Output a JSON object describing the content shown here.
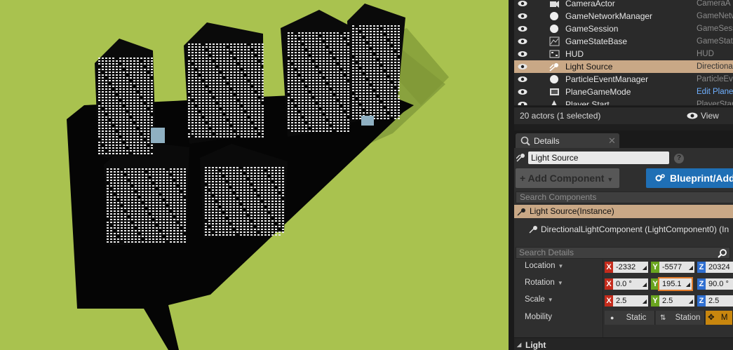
{
  "outliner": {
    "rows": [
      {
        "name": "CameraActor",
        "type": "CameraA",
        "icon": "camera-actor-icon"
      },
      {
        "name": "GameNetworkManager",
        "type": "GameNetw",
        "icon": "sphere-icon"
      },
      {
        "name": "GameSession",
        "type": "GameSess",
        "icon": "sphere-icon"
      },
      {
        "name": "GameStateBase",
        "type": "GameStat",
        "icon": "graph-icon"
      },
      {
        "name": "HUD",
        "type": "HUD",
        "icon": "hud-icon"
      },
      {
        "name": "Light Source",
        "type": "Directiona",
        "icon": "directional-light-icon"
      },
      {
        "name": "ParticleEventManager",
        "type": "ParticleEv",
        "icon": "sphere-icon"
      },
      {
        "name": "PlaneGameMode",
        "type": "Edit Plane",
        "icon": "game-mode-icon"
      },
      {
        "name": "Player Start",
        "type": "PlayerStar",
        "icon": "player-start-icon"
      }
    ],
    "footer_count": "20 actors (1 selected)",
    "footer_view": "View"
  },
  "details": {
    "tab_label": "Details",
    "tab_close": "✕",
    "actor_name": "Light Source",
    "help": "?",
    "add_component": "+ Add Component",
    "blueprint": "Blueprint/Add",
    "search_components_placeholder": "Search Components",
    "component_instance": "Light Source(Instance)",
    "component_child": "DirectionalLightComponent (LightComponent0) (In",
    "search_details_placeholder": "Search Details",
    "transform": {
      "location": {
        "label": "Location",
        "x": "-2332",
        "y": "-5577",
        "z": "20324"
      },
      "rotation": {
        "label": "Rotation",
        "x": "0.0 °",
        "y": "195.1",
        "z": "90.0 °"
      },
      "scale": {
        "label": "Scale",
        "x": "2.5",
        "y": "2.5",
        "z": "2.5"
      }
    },
    "mobility": {
      "label": "Mobility",
      "options": [
        "Static",
        "Station",
        "M"
      ]
    },
    "section_light": "Light"
  },
  "axis_labels": {
    "x": "X",
    "y": "Y",
    "z": "Z"
  },
  "colors": {
    "viewport_ground": "#a9c24f",
    "selection": "#c9a886",
    "axis_x": "#c42b1c",
    "axis_y": "#6aa51f",
    "axis_z": "#2f6fd1",
    "blueprint_button": "#1f6fb5",
    "mobility_active": "#c8860e"
  }
}
